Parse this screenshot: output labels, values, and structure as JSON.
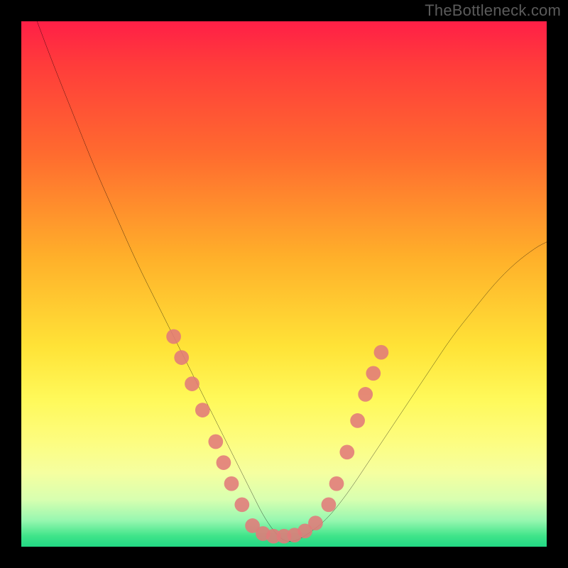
{
  "watermark": "TheBottleneck.com",
  "chart_data": {
    "type": "line",
    "title": "",
    "xlabel": "",
    "ylabel": "",
    "xlim": [
      0,
      100
    ],
    "ylim": [
      0,
      100
    ],
    "series": [
      {
        "name": "bottleneck-curve",
        "x": [
          3,
          6,
          10,
          14,
          18,
          22,
          26,
          30,
          34,
          38,
          40,
          42,
          44,
          46,
          48,
          50,
          52,
          54,
          58,
          62,
          66,
          70,
          74,
          78,
          82,
          86,
          90,
          94,
          98,
          100
        ],
        "y": [
          100,
          92,
          82,
          72,
          63,
          54,
          46,
          38,
          30,
          22,
          18,
          14,
          10,
          6,
          3,
          1,
          1,
          2,
          5,
          10,
          16,
          22,
          28,
          34,
          40,
          45,
          50,
          54,
          57,
          58
        ]
      }
    ],
    "markers": [
      {
        "segment": "left",
        "x": 29,
        "y": 40
      },
      {
        "segment": "left",
        "x": 30.5,
        "y": 36
      },
      {
        "segment": "left",
        "x": 32.5,
        "y": 31
      },
      {
        "segment": "left",
        "x": 34.5,
        "y": 26
      },
      {
        "segment": "left",
        "x": 37,
        "y": 20
      },
      {
        "segment": "left",
        "x": 38.5,
        "y": 16
      },
      {
        "segment": "left",
        "x": 40,
        "y": 12
      },
      {
        "segment": "left",
        "x": 42,
        "y": 8
      },
      {
        "segment": "bottom",
        "x": 44,
        "y": 4
      },
      {
        "segment": "bottom",
        "x": 46,
        "y": 2.5
      },
      {
        "segment": "bottom",
        "x": 48,
        "y": 2
      },
      {
        "segment": "bottom",
        "x": 50,
        "y": 2
      },
      {
        "segment": "bottom",
        "x": 52,
        "y": 2.2
      },
      {
        "segment": "bottom",
        "x": 54,
        "y": 3
      },
      {
        "segment": "bottom",
        "x": 56,
        "y": 4.5
      },
      {
        "segment": "right",
        "x": 58.5,
        "y": 8
      },
      {
        "segment": "right",
        "x": 60,
        "y": 12
      },
      {
        "segment": "right",
        "x": 62,
        "y": 18
      },
      {
        "segment": "right",
        "x": 64,
        "y": 24
      },
      {
        "segment": "right",
        "x": 65.5,
        "y": 29
      },
      {
        "segment": "right",
        "x": 67,
        "y": 33
      },
      {
        "segment": "right",
        "x": 68.5,
        "y": 37
      }
    ],
    "marker_fill": "#e17a7a",
    "marker_radius_pct": 1.4,
    "curve_stroke": "#000000",
    "gradient_stops": [
      {
        "pos": 0,
        "color": "#ff1f47"
      },
      {
        "pos": 25,
        "color": "#ff6a2f"
      },
      {
        "pos": 50,
        "color": "#ffd338"
      },
      {
        "pos": 75,
        "color": "#fcfd6c"
      },
      {
        "pos": 100,
        "color": "#22d784"
      }
    ]
  }
}
